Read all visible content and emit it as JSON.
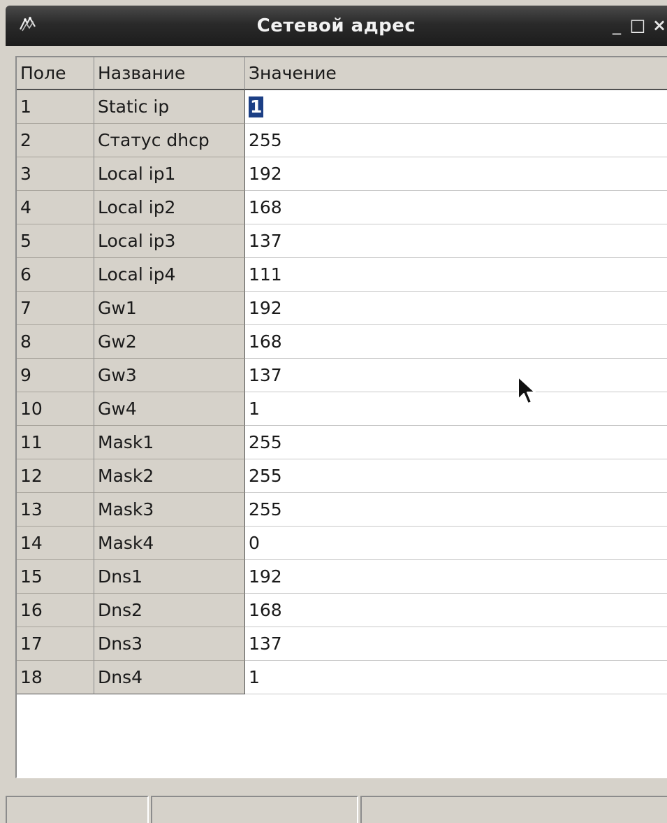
{
  "window": {
    "title": "Сетевой адрес",
    "icons": {
      "app": "app-logo-icon",
      "minimize": "minimize-icon",
      "maximize": "maximize-icon",
      "close": "close-icon"
    },
    "buttons": {
      "minimize_label": "_",
      "maximize_label": "□",
      "close_label": "×"
    }
  },
  "table": {
    "columns": [
      "Поле",
      "Название",
      "Значение"
    ],
    "rows": [
      {
        "field": "1",
        "name": "Static ip",
        "value": "1"
      },
      {
        "field": "2",
        "name": "Статус dhcp",
        "value": "255"
      },
      {
        "field": "3",
        "name": "Local ip1",
        "value": "192"
      },
      {
        "field": "4",
        "name": "Local ip2",
        "value": "168"
      },
      {
        "field": "5",
        "name": "Local ip3",
        "value": "137"
      },
      {
        "field": "6",
        "name": "Local ip4",
        "value": "111"
      },
      {
        "field": "7",
        "name": "Gw1",
        "value": "192"
      },
      {
        "field": "8",
        "name": "Gw2",
        "value": "168"
      },
      {
        "field": "9",
        "name": "Gw3",
        "value": "137"
      },
      {
        "field": "10",
        "name": "Gw4",
        "value": "1"
      },
      {
        "field": "11",
        "name": "Mask1",
        "value": "255"
      },
      {
        "field": "12",
        "name": "Mask2",
        "value": "255"
      },
      {
        "field": "13",
        "name": "Mask3",
        "value": "255"
      },
      {
        "field": "14",
        "name": "Mask4",
        "value": "0"
      },
      {
        "field": "15",
        "name": "Dns1",
        "value": "192"
      },
      {
        "field": "16",
        "name": "Dns2",
        "value": "168"
      },
      {
        "field": "17",
        "name": "Dns3",
        "value": "137"
      },
      {
        "field": "18",
        "name": "Dns4",
        "value": "1"
      }
    ]
  },
  "colors": {
    "selection": "#1c3f85",
    "panel": "#d6d2ca"
  }
}
